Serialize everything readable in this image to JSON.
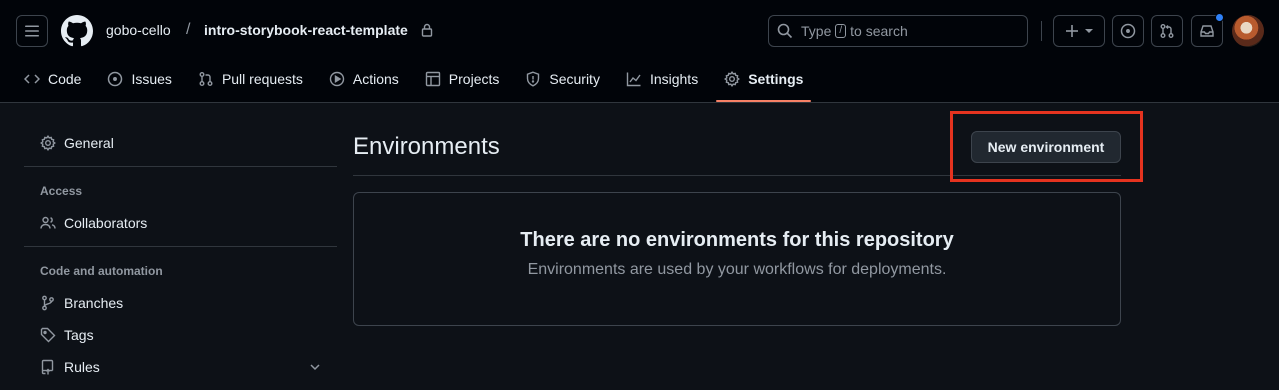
{
  "header": {
    "owner": "gobo-cello",
    "separator": "/",
    "repo": "intro-storybook-react-template",
    "search_prefix": "Type",
    "search_key": "/",
    "search_suffix": "to search"
  },
  "nav": {
    "tabs": [
      {
        "label": "Code",
        "icon": "code-icon"
      },
      {
        "label": "Issues",
        "icon": "issue-opened-icon"
      },
      {
        "label": "Pull requests",
        "icon": "git-pull-request-icon"
      },
      {
        "label": "Actions",
        "icon": "play-icon"
      },
      {
        "label": "Projects",
        "icon": "table-icon"
      },
      {
        "label": "Security",
        "icon": "shield-icon"
      },
      {
        "label": "Insights",
        "icon": "graph-icon"
      },
      {
        "label": "Settings",
        "icon": "gear-icon",
        "active": true
      }
    ]
  },
  "sidebar": {
    "general": "General",
    "access_heading": "Access",
    "collaborators": "Collaborators",
    "code_heading": "Code and automation",
    "branches": "Branches",
    "tags": "Tags",
    "rules": "Rules"
  },
  "main": {
    "title": "Environments",
    "new_button": "New environment",
    "empty_title": "There are no environments for this repository",
    "empty_desc": "Environments are used by your workflows for deployments."
  },
  "colors": {
    "bg": "#0d1117",
    "header_bg": "#010409",
    "accent_underline": "#f78166",
    "highlight": "#e5331f",
    "notification": "#2f81f7"
  }
}
